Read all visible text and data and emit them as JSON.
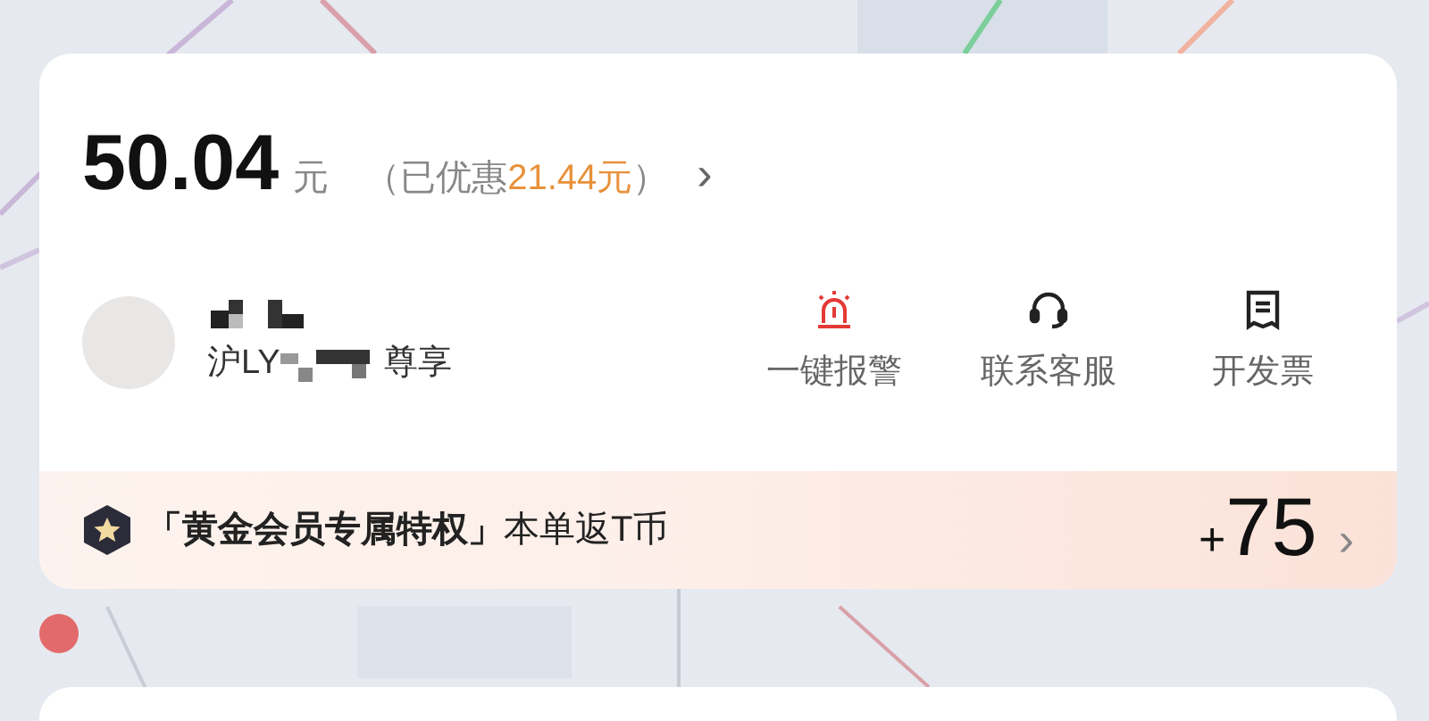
{
  "fare": {
    "amount": "50.04",
    "unit": "元",
    "discount_prefix": "（已优惠",
    "discount_amount": "21.44元",
    "discount_suffix": "）",
    "chevron": "›"
  },
  "driver": {
    "plate_prefix": "沪LY",
    "badge": "尊享"
  },
  "actions": [
    {
      "kind": "alarm",
      "label": "一键报警"
    },
    {
      "kind": "service",
      "label": "联系客服"
    },
    {
      "kind": "invoice",
      "label": "开发票"
    }
  ],
  "membership": {
    "title": "「黄金会员专属特权」",
    "text": "本单返T币",
    "plus": "+",
    "points": "75",
    "chevron": "›"
  }
}
